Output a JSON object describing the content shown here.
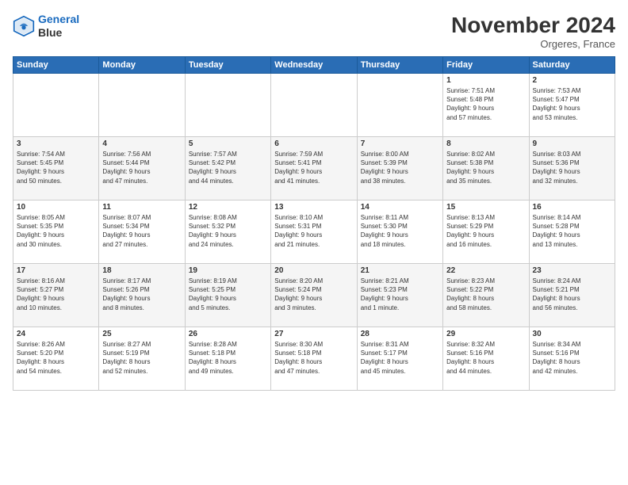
{
  "header": {
    "logo_line1": "General",
    "logo_line2": "Blue",
    "month": "November 2024",
    "location": "Orgeres, France"
  },
  "weekdays": [
    "Sunday",
    "Monday",
    "Tuesday",
    "Wednesday",
    "Thursday",
    "Friday",
    "Saturday"
  ],
  "weeks": [
    [
      {
        "day": "",
        "info": ""
      },
      {
        "day": "",
        "info": ""
      },
      {
        "day": "",
        "info": ""
      },
      {
        "day": "",
        "info": ""
      },
      {
        "day": "",
        "info": ""
      },
      {
        "day": "1",
        "info": "Sunrise: 7:51 AM\nSunset: 5:48 PM\nDaylight: 9 hours\nand 57 minutes."
      },
      {
        "day": "2",
        "info": "Sunrise: 7:53 AM\nSunset: 5:47 PM\nDaylight: 9 hours\nand 53 minutes."
      }
    ],
    [
      {
        "day": "3",
        "info": "Sunrise: 7:54 AM\nSunset: 5:45 PM\nDaylight: 9 hours\nand 50 minutes."
      },
      {
        "day": "4",
        "info": "Sunrise: 7:56 AM\nSunset: 5:44 PM\nDaylight: 9 hours\nand 47 minutes."
      },
      {
        "day": "5",
        "info": "Sunrise: 7:57 AM\nSunset: 5:42 PM\nDaylight: 9 hours\nand 44 minutes."
      },
      {
        "day": "6",
        "info": "Sunrise: 7:59 AM\nSunset: 5:41 PM\nDaylight: 9 hours\nand 41 minutes."
      },
      {
        "day": "7",
        "info": "Sunrise: 8:00 AM\nSunset: 5:39 PM\nDaylight: 9 hours\nand 38 minutes."
      },
      {
        "day": "8",
        "info": "Sunrise: 8:02 AM\nSunset: 5:38 PM\nDaylight: 9 hours\nand 35 minutes."
      },
      {
        "day": "9",
        "info": "Sunrise: 8:03 AM\nSunset: 5:36 PM\nDaylight: 9 hours\nand 32 minutes."
      }
    ],
    [
      {
        "day": "10",
        "info": "Sunrise: 8:05 AM\nSunset: 5:35 PM\nDaylight: 9 hours\nand 30 minutes."
      },
      {
        "day": "11",
        "info": "Sunrise: 8:07 AM\nSunset: 5:34 PM\nDaylight: 9 hours\nand 27 minutes."
      },
      {
        "day": "12",
        "info": "Sunrise: 8:08 AM\nSunset: 5:32 PM\nDaylight: 9 hours\nand 24 minutes."
      },
      {
        "day": "13",
        "info": "Sunrise: 8:10 AM\nSunset: 5:31 PM\nDaylight: 9 hours\nand 21 minutes."
      },
      {
        "day": "14",
        "info": "Sunrise: 8:11 AM\nSunset: 5:30 PM\nDaylight: 9 hours\nand 18 minutes."
      },
      {
        "day": "15",
        "info": "Sunrise: 8:13 AM\nSunset: 5:29 PM\nDaylight: 9 hours\nand 16 minutes."
      },
      {
        "day": "16",
        "info": "Sunrise: 8:14 AM\nSunset: 5:28 PM\nDaylight: 9 hours\nand 13 minutes."
      }
    ],
    [
      {
        "day": "17",
        "info": "Sunrise: 8:16 AM\nSunset: 5:27 PM\nDaylight: 9 hours\nand 10 minutes."
      },
      {
        "day": "18",
        "info": "Sunrise: 8:17 AM\nSunset: 5:26 PM\nDaylight: 9 hours\nand 8 minutes."
      },
      {
        "day": "19",
        "info": "Sunrise: 8:19 AM\nSunset: 5:25 PM\nDaylight: 9 hours\nand 5 minutes."
      },
      {
        "day": "20",
        "info": "Sunrise: 8:20 AM\nSunset: 5:24 PM\nDaylight: 9 hours\nand 3 minutes."
      },
      {
        "day": "21",
        "info": "Sunrise: 8:21 AM\nSunset: 5:23 PM\nDaylight: 9 hours\nand 1 minute."
      },
      {
        "day": "22",
        "info": "Sunrise: 8:23 AM\nSunset: 5:22 PM\nDaylight: 8 hours\nand 58 minutes."
      },
      {
        "day": "23",
        "info": "Sunrise: 8:24 AM\nSunset: 5:21 PM\nDaylight: 8 hours\nand 56 minutes."
      }
    ],
    [
      {
        "day": "24",
        "info": "Sunrise: 8:26 AM\nSunset: 5:20 PM\nDaylight: 8 hours\nand 54 minutes."
      },
      {
        "day": "25",
        "info": "Sunrise: 8:27 AM\nSunset: 5:19 PM\nDaylight: 8 hours\nand 52 minutes."
      },
      {
        "day": "26",
        "info": "Sunrise: 8:28 AM\nSunset: 5:18 PM\nDaylight: 8 hours\nand 49 minutes."
      },
      {
        "day": "27",
        "info": "Sunrise: 8:30 AM\nSunset: 5:18 PM\nDaylight: 8 hours\nand 47 minutes."
      },
      {
        "day": "28",
        "info": "Sunrise: 8:31 AM\nSunset: 5:17 PM\nDaylight: 8 hours\nand 45 minutes."
      },
      {
        "day": "29",
        "info": "Sunrise: 8:32 AM\nSunset: 5:16 PM\nDaylight: 8 hours\nand 44 minutes."
      },
      {
        "day": "30",
        "info": "Sunrise: 8:34 AM\nSunset: 5:16 PM\nDaylight: 8 hours\nand 42 minutes."
      }
    ]
  ]
}
